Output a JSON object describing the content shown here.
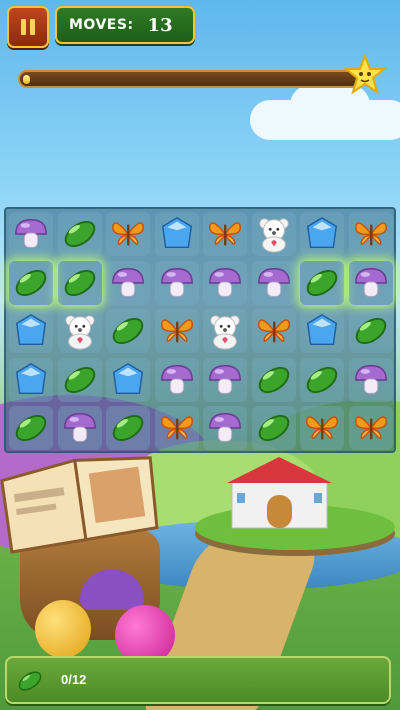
{
  "hud": {
    "moves_label": "MOVES:",
    "moves_value": "13",
    "progress_fraction": 0.02
  },
  "board": {
    "rows": 5,
    "cols": 8,
    "grid": [
      [
        "mushroom",
        "cucumber",
        "butterfly",
        "diamond",
        "butterfly",
        "bear",
        "diamond",
        "butterfly"
      ],
      [
        "cucumber",
        "cucumber",
        "mushroom",
        "mushroom",
        "mushroom",
        "mushroom",
        "cucumber",
        "mushroom"
      ],
      [
        "diamond",
        "bear",
        "cucumber",
        "butterfly",
        "bear",
        "butterfly",
        "diamond",
        "cucumber"
      ],
      [
        "diamond",
        "cucumber",
        "diamond",
        "mushroom",
        "mushroom",
        "cucumber",
        "cucumber",
        "mushroom"
      ],
      [
        "cucumber",
        "mushroom",
        "cucumber",
        "butterfly",
        "mushroom",
        "cucumber",
        "butterfly",
        "butterfly"
      ]
    ],
    "glowing": [
      [
        1,
        0
      ],
      [
        1,
        1
      ],
      [
        1,
        6
      ],
      [
        1,
        7
      ]
    ]
  },
  "goal": {
    "icon": "cucumber-icon",
    "count": "0/12"
  },
  "colors": {
    "cucumber": "#3aa52a",
    "mushroom": "#a46ad0",
    "butterfly": "#f39a1a",
    "diamond": "#4aa6ee",
    "bear": "#ffffff"
  }
}
